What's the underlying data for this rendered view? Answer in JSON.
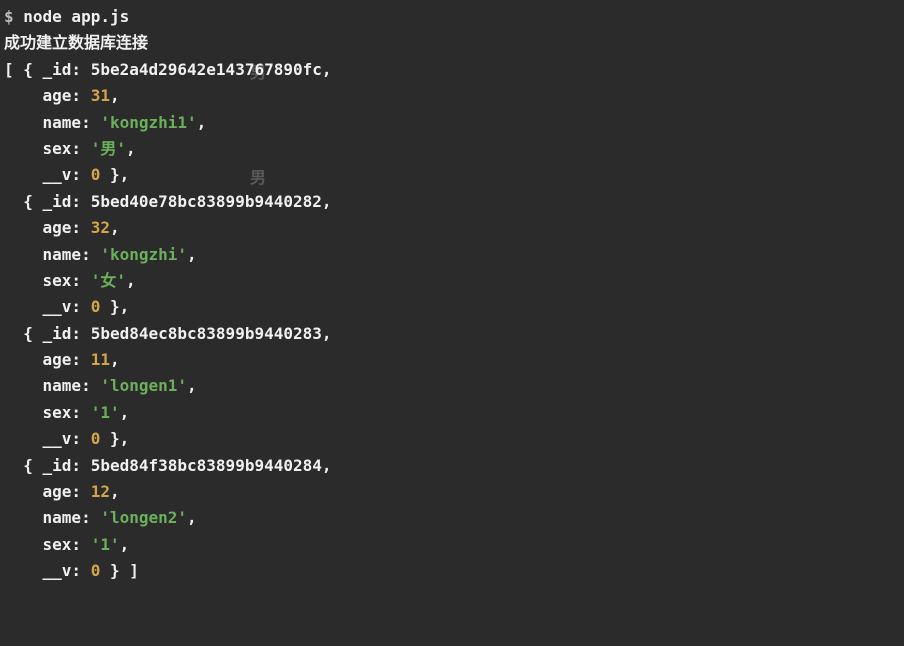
{
  "prompt": "$ ",
  "command": "node app.js",
  "connection_msg": "成功建立数据库连接",
  "ghost_text_1": "男",
  "ghost_text_2": "男",
  "records": [
    {
      "_id": "5be2a4d29642e143767890fc",
      "age": 31,
      "name": "'kongzhi1'",
      "sex": "'男'",
      "__v": 0
    },
    {
      "_id": "5bed40e78bc83899b9440282",
      "age": 32,
      "name": "'kongzhi'",
      "sex": "'女'",
      "__v": 0
    },
    {
      "_id": "5bed84ec8bc83899b9440283",
      "age": 11,
      "name": "'longen1'",
      "sex": "'1'",
      "__v": 0
    },
    {
      "_id": "5bed84f38bc83899b9440284",
      "age": 12,
      "name": "'longen2'",
      "sex": "'1'",
      "__v": 0
    }
  ],
  "labels": {
    "id": "_id:",
    "age": "age:",
    "name": "name:",
    "sex": "sex:",
    "v": "__v:"
  }
}
